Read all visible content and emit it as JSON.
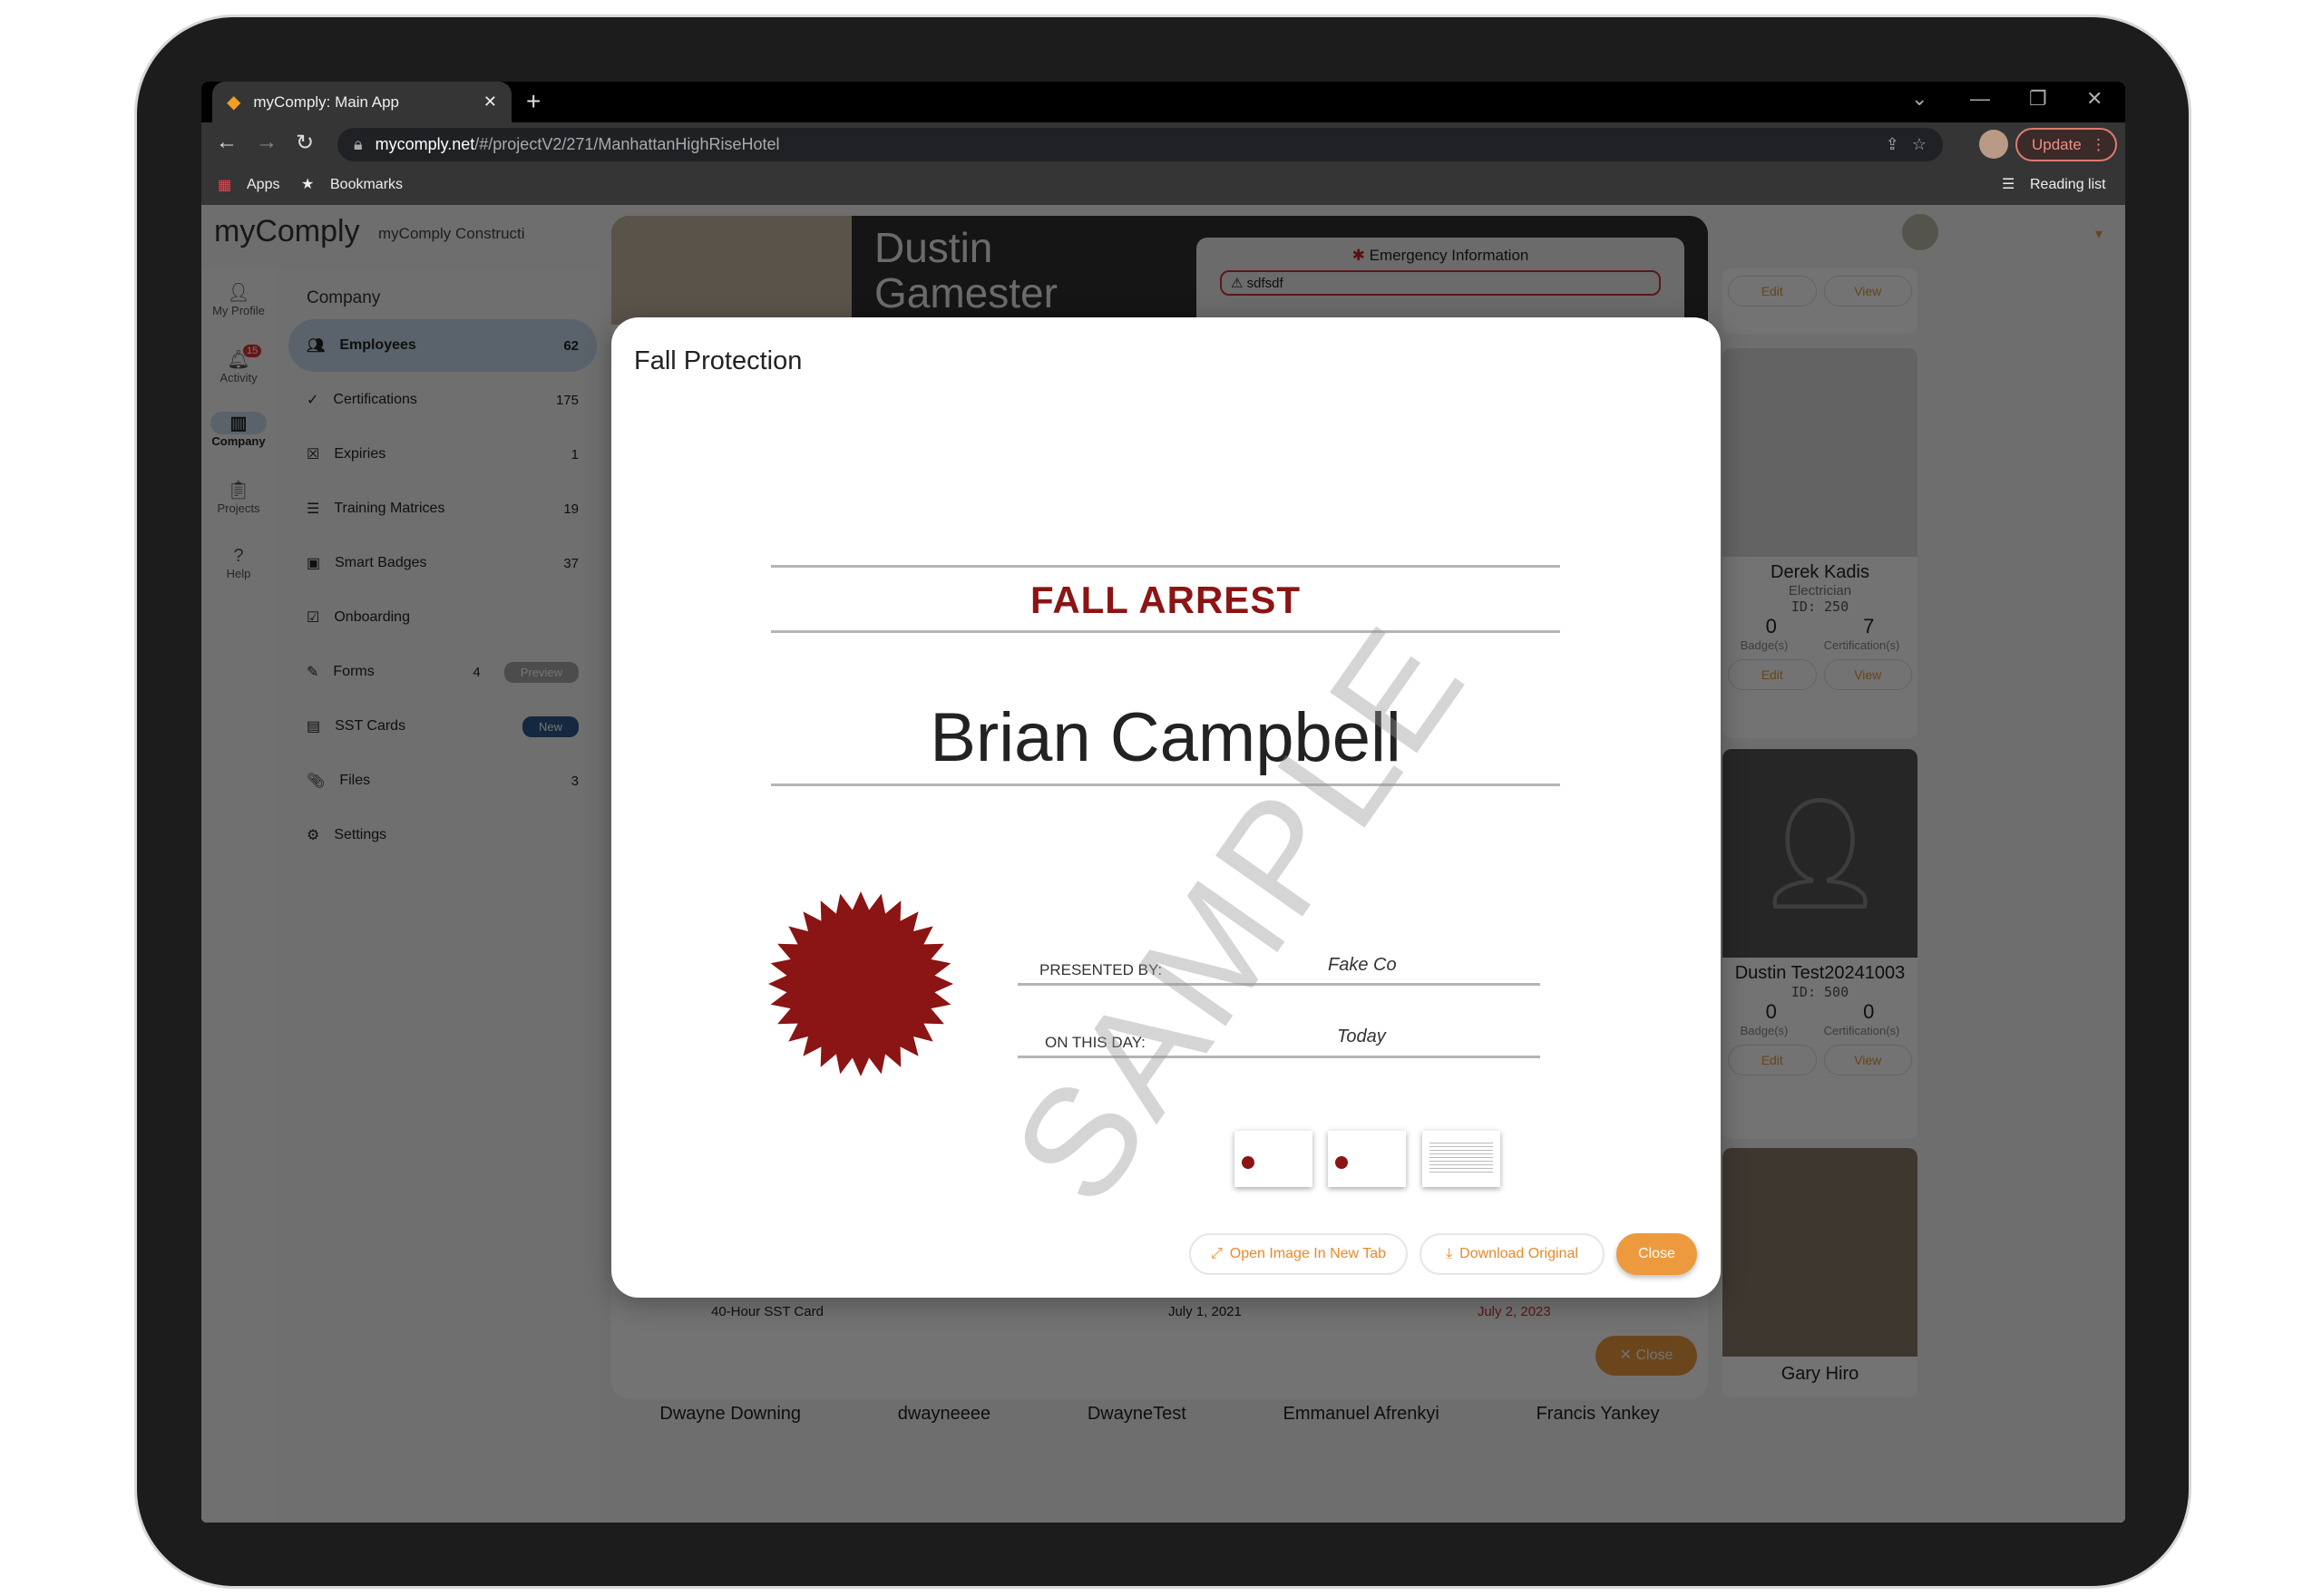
{
  "browser": {
    "tab_title": "myComply: Main App",
    "url_host": "mycomply.net",
    "url_path": "/#/projectV2/271/ManhattanHighRiseHotel",
    "update_label": "Update",
    "bookmarks": [
      {
        "label": "Apps",
        "icon": "apps-grid-icon"
      },
      {
        "label": "Bookmarks",
        "icon": "star-icon"
      }
    ],
    "reading_list": "Reading list"
  },
  "app": {
    "logo": "myComply",
    "company_name": "myComply Constructi",
    "rail": [
      {
        "label": "My Profile"
      },
      {
        "label": "Activity",
        "badge": "15"
      },
      {
        "label": "Company",
        "active": true
      },
      {
        "label": "Projects"
      },
      {
        "label": "Help"
      }
    ],
    "sidebar": {
      "heading": "Company",
      "items": [
        {
          "label": "Employees",
          "count": "62",
          "active": true
        },
        {
          "label": "Certifications",
          "count": "175"
        },
        {
          "label": "Expiries",
          "count": "1"
        },
        {
          "label": "Training Matrices",
          "count": "19"
        },
        {
          "label": "Smart Badges",
          "count": "37"
        },
        {
          "label": "Onboarding",
          "count": ""
        },
        {
          "label": "Forms",
          "count": "4",
          "pill": "Preview"
        },
        {
          "label": "SST Cards",
          "count": "",
          "pill": "New"
        },
        {
          "label": "Files",
          "count": "3"
        },
        {
          "label": "Settings",
          "count": ""
        }
      ]
    },
    "cards": [
      {
        "name": "Derek Kadis",
        "role": "Electrician",
        "id": "ID: 250",
        "badges": "0",
        "certs": "7"
      },
      {
        "name": "Dustin Test20241003",
        "role": "",
        "id": "ID: 500",
        "badges": "0",
        "certs": "0"
      },
      {
        "name": "Gary Hiro"
      }
    ],
    "card_labels": {
      "badges": "Badge(s)",
      "certs": "Certification(s)",
      "edit": "Edit",
      "view": "View"
    },
    "bottom_names": [
      "Dwayne Downing",
      "dwayneeee",
      "DwayneTest",
      "Emmanuel Afrenkyi",
      "Francis Yankey"
    ]
  },
  "profile_modal": {
    "first_name": "Dustin",
    "last_name": "Gamester",
    "emergency_title": "Emergency Information",
    "emergency_value": "sdfsdf",
    "row": {
      "name": "40-Hour SST Card",
      "issued": "July 1, 2021",
      "expires": "July 2, 2023"
    },
    "close_label": "Close"
  },
  "image_modal": {
    "title": "Fall Protection",
    "certificate": {
      "heading": "FALL ARREST",
      "recipient": "Brian Campbell",
      "presented_by_label": "PRESENTED BY:",
      "presented_by": "Fake Co",
      "date_label": "ON THIS DAY:",
      "date": "Today",
      "watermark": "SAMPLE"
    },
    "thumbnail_count": 3,
    "buttons": {
      "open": "Open Image In New Tab",
      "download": "Download Original",
      "close": "Close"
    }
  },
  "colors": {
    "accent": "#ed9a3e",
    "cert_red": "#8b1414",
    "active_nav": "#c8dcee",
    "new_pill": "#2d5a8c"
  }
}
